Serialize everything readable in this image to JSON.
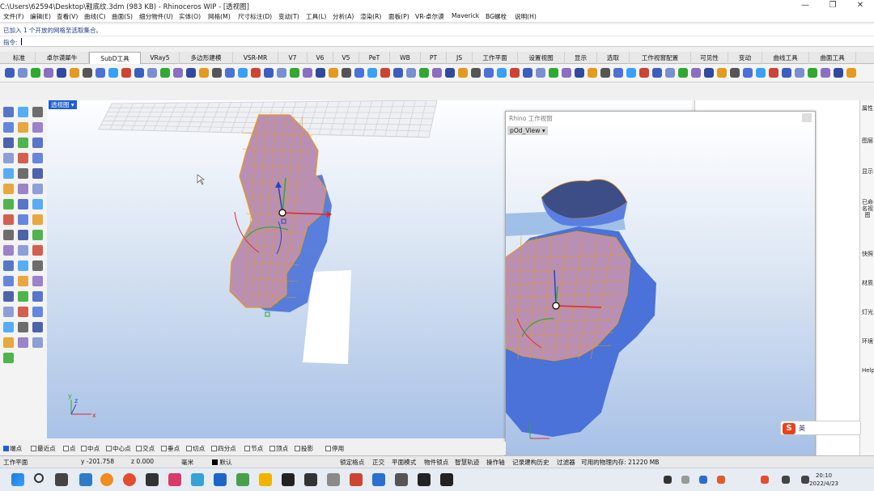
{
  "window": {
    "title": "C:\\Users\\62594\\Desktop\\鞋底纹.3dm (983 KB) - Rhinoceros WIP - [透视图]",
    "controls": [
      "—",
      "❐",
      "✕"
    ]
  },
  "menu": [
    "文件(F)",
    "编辑(E)",
    "查看(V)",
    "曲线(C)",
    "曲面(S)",
    "细分物件(U)",
    "实体(O)",
    "网格(M)",
    "尺寸标注(D)",
    "变动(T)",
    "工具(L)",
    "分析(A)",
    "渲染(R)",
    "面板(P)",
    "VR-卓尔谟",
    "Maverick",
    "BG螺栓",
    "说明(H)"
  ],
  "command": {
    "history": "已加入 1 个开放的网格至选取集合。",
    "prompt_label": "指令:",
    "input_value": ""
  },
  "toolbar_tabs": [
    "标准",
    "卓尔谟犀牛",
    "SubD工具",
    "VRay5",
    "多边形建模",
    "VSR-MR",
    "V7",
    "V6",
    "V5",
    "PeT",
    "WB",
    "PT",
    "JS",
    "工作平面",
    "设置视图",
    "显示",
    "选取",
    "工作视窗配置",
    "可见性",
    "变动",
    "曲线工具",
    "曲面工具"
  ],
  "active_tab": "SubD工具",
  "viewport": {
    "label": "透视图",
    "axis": {
      "x": "x",
      "y": "y",
      "z": "z"
    }
  },
  "float_viewport": {
    "window_title": "Rhino 工作视窗",
    "label": "pOd_View"
  },
  "right_panel_tabs": [
    "属性",
    "图层",
    "显示",
    "已命名视图",
    "快照",
    "材质",
    "灯光",
    "环境",
    "Help"
  ],
  "osnap": [
    {
      "label": "端点",
      "on": true
    },
    {
      "label": "最近点",
      "on": false
    },
    {
      "label": "点",
      "on": false
    },
    {
      "label": "中点",
      "on": false
    },
    {
      "label": "中心点",
      "on": false
    },
    {
      "label": "交点",
      "on": false
    },
    {
      "label": "垂点",
      "on": false
    },
    {
      "label": "切点",
      "on": false
    },
    {
      "label": "四分点",
      "on": false
    },
    {
      "label": "节点",
      "on": false
    },
    {
      "label": "顶点",
      "on": false
    },
    {
      "label": "投影",
      "on": false
    },
    {
      "label": "停用",
      "on": false
    }
  ],
  "status": {
    "cplane": "工作平面",
    "y": "y -201.758",
    "z": "z 0.000",
    "unit": "毫米",
    "layer": "默认",
    "items": [
      "锁定格点",
      "正交",
      "平面模式",
      "物件锁点",
      "智慧轨迹",
      "操作轴",
      "记录建构历史",
      "过滤器"
    ],
    "memory": "可用的物理内存: 21220 MB"
  },
  "ime": {
    "mode": "英"
  },
  "clock": {
    "time": "20:10",
    "date": "2022/4/23"
  },
  "colors": {
    "accent": "#1f5fd6",
    "mesh_fill": "#b98fb4",
    "mesh_edge": "#e39a1f",
    "mesh_under": "#4a72d8"
  }
}
